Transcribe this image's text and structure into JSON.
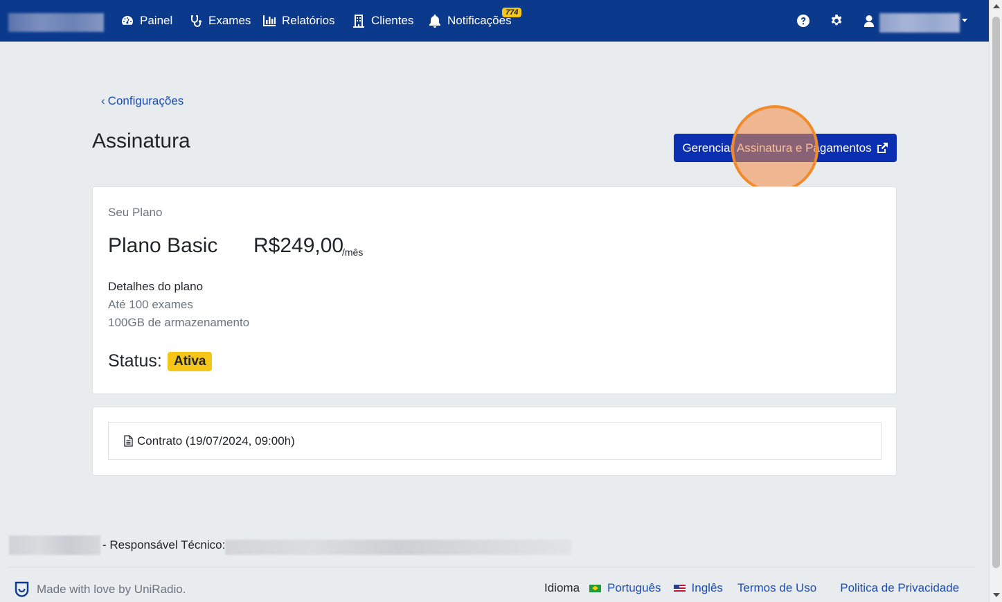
{
  "navbar": {
    "items": [
      {
        "label": "Painel",
        "icon": "dashboard-icon"
      },
      {
        "label": "Exames",
        "icon": "stethoscope-icon"
      },
      {
        "label": "Relatórios",
        "icon": "bar-chart-icon"
      },
      {
        "label": "Clientes",
        "icon": "building-icon"
      },
      {
        "label": "Notificações",
        "icon": "bell-icon"
      }
    ],
    "notifications_badge": "774",
    "right_icons": [
      "help-icon",
      "gear-icon",
      "user-icon"
    ],
    "colors": {
      "background": "#0b3a8c",
      "badge": "#f5c518"
    }
  },
  "breadcrumb": {
    "back_label": "Configurações"
  },
  "page": {
    "title": "Assinatura",
    "manage_button_label": "Gerenciar Assinatura e Pagamentos"
  },
  "plan": {
    "section_label": "Seu Plano",
    "name": "Plano Basic",
    "price": "R$249,00",
    "period": "/mês",
    "details_title": "Detalhes do plano",
    "details": [
      "Até 100 exames",
      "100GB de armazenamento"
    ],
    "status_label": "Status:",
    "status_value": "Ativa"
  },
  "contract": {
    "label": "Contrato (19/07/2024, 09:00h)",
    "icon": "file-text-icon"
  },
  "footer": {
    "responsible_label": "- Responsável Técnico:",
    "made_with": "Made with love by UniRadio.",
    "language_label": "Idioma",
    "languages": [
      "Português",
      "Inglês"
    ],
    "terms": "Termos de Uso",
    "privacy": "Politica de Privacidade"
  }
}
